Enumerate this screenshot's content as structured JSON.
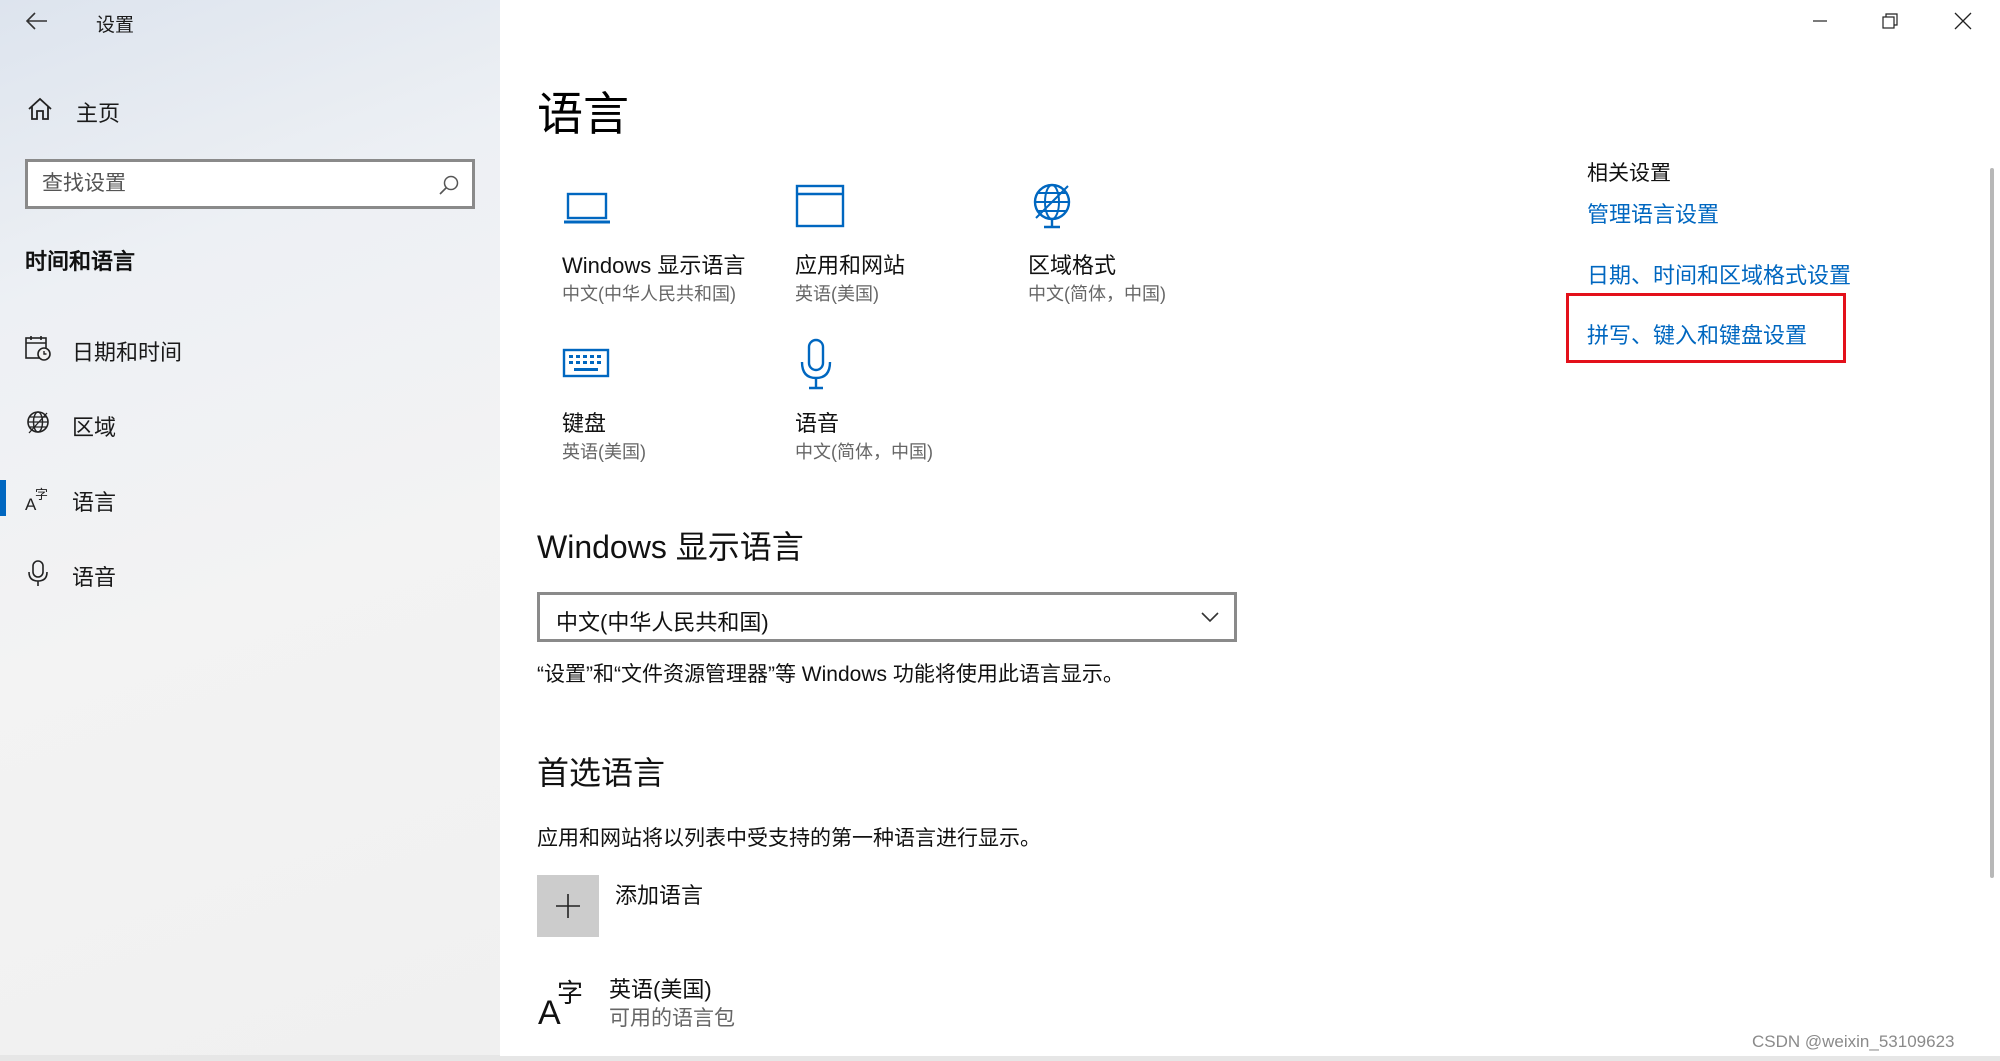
{
  "window": {
    "title": "设置",
    "controls": [
      "minimize-icon",
      "restore-icon",
      "close-icon"
    ]
  },
  "sidebar": {
    "home_label": "主页",
    "search_placeholder": "查找设置",
    "section_title": "时间和语言",
    "items": [
      {
        "label": "日期和时间",
        "icon": "calendar-clock-icon"
      },
      {
        "label": "区域",
        "icon": "globe-icon"
      },
      {
        "label": "语言",
        "icon": "language-icon",
        "active": true
      },
      {
        "label": "语音",
        "icon": "microphone-icon"
      }
    ]
  },
  "main": {
    "title": "语言",
    "tiles": [
      {
        "title": "Windows 显示语言",
        "subtitle": "中文(中华人民共和国)",
        "icon": "laptop-icon"
      },
      {
        "title": "应用和网站",
        "subtitle": "英语(美国)",
        "icon": "browser-window-icon"
      },
      {
        "title": "区域格式",
        "subtitle": "中文(简体，中国)",
        "icon": "globe-format-icon"
      },
      {
        "title": "键盘",
        "subtitle": "英语(美国)",
        "icon": "keyboard-icon"
      },
      {
        "title": "语音",
        "subtitle": "中文(简体，中国)",
        "icon": "microphone-icon"
      }
    ],
    "display_language": {
      "heading": "Windows 显示语言",
      "selected": "中文(中华人民共和国)",
      "description": "“设置”和“文件资源管理器”等 Windows 功能将使用此语言显示。"
    },
    "preferred": {
      "heading": "首选语言",
      "description": "应用和网站将以列表中受支持的第一种语言进行显示。",
      "add_label": "添加语言",
      "languages": [
        {
          "name": "英语(美国)",
          "status": "可用的语言包"
        }
      ]
    }
  },
  "related": {
    "heading": "相关设置",
    "links": [
      "管理语言设置",
      "日期、时间和区域格式设置",
      "拼写、键入和键盘设置"
    ],
    "highlight_color": "#e3101a"
  },
  "accent_color": "#0067c0",
  "watermark": "CSDN @weixin_53109623"
}
